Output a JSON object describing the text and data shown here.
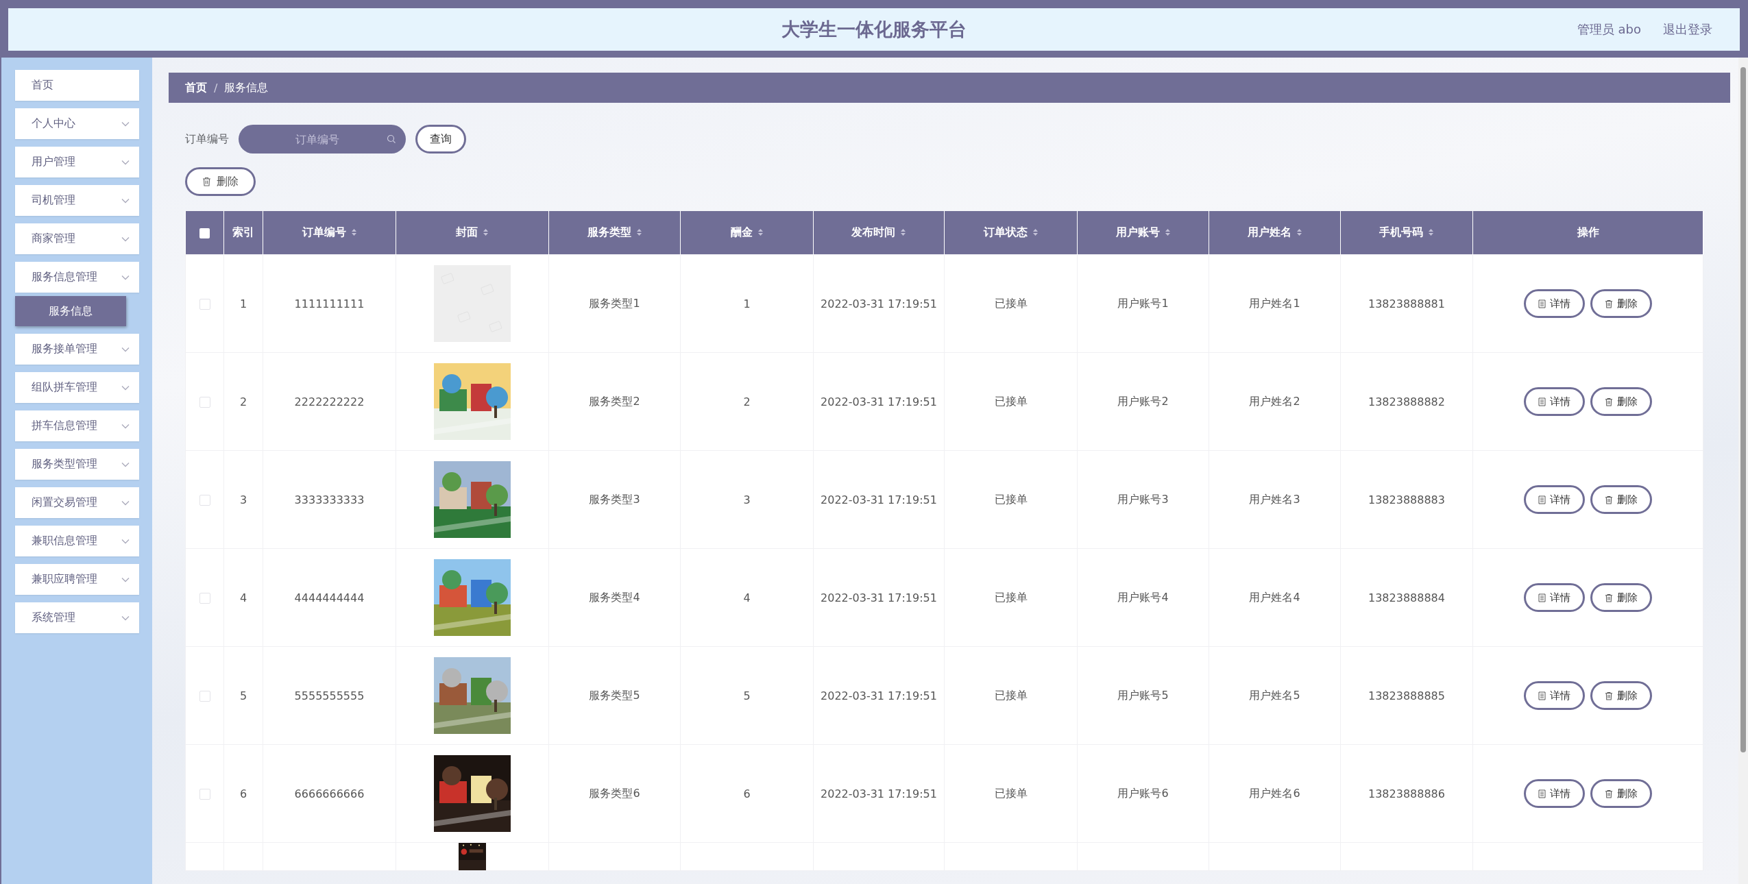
{
  "header": {
    "title": "大学生一体化服务平台",
    "user": "管理员 abo",
    "logout": "退出登录"
  },
  "sidebar": {
    "items": [
      {
        "label": "首页",
        "expandable": false
      },
      {
        "label": "个人中心",
        "expandable": true
      },
      {
        "label": "用户管理",
        "expandable": true
      },
      {
        "label": "司机管理",
        "expandable": true
      },
      {
        "label": "商家管理",
        "expandable": true
      },
      {
        "label": "服务信息管理",
        "expandable": true,
        "children": [
          {
            "label": "服务信息",
            "selected": true
          }
        ]
      },
      {
        "label": "服务接单管理",
        "expandable": true
      },
      {
        "label": "组队拼车管理",
        "expandable": true
      },
      {
        "label": "拼车信息管理",
        "expandable": true
      },
      {
        "label": "服务类型管理",
        "expandable": true
      },
      {
        "label": "闲置交易管理",
        "expandable": true
      },
      {
        "label": "兼职信息管理",
        "expandable": true
      },
      {
        "label": "兼职应聘管理",
        "expandable": true
      },
      {
        "label": "系统管理",
        "expandable": true
      }
    ]
  },
  "breadcrumb": {
    "items": [
      "首页",
      "服务信息"
    ],
    "separator": "/"
  },
  "search": {
    "label": "订单编号",
    "placeholder": "订单编号",
    "button": "查询"
  },
  "delete_button": "删除",
  "table": {
    "select_all": {
      "checked": false
    },
    "columns": [
      {
        "label": "索引",
        "sortable": false
      },
      {
        "label": "订单编号",
        "sortable": true
      },
      {
        "label": "封面",
        "sortable": true
      },
      {
        "label": "服务类型",
        "sortable": true
      },
      {
        "label": "酬金",
        "sortable": true
      },
      {
        "label": "发布时间",
        "sortable": true
      },
      {
        "label": "订单状态",
        "sortable": true
      },
      {
        "label": "用户账号",
        "sortable": true
      },
      {
        "label": "用户姓名",
        "sortable": true
      },
      {
        "label": "手机号码",
        "sortable": true
      },
      {
        "label": "操作",
        "sortable": false
      }
    ],
    "rows": [
      {
        "selected": false,
        "index": "1",
        "order_no": "1111111111",
        "cover": {
          "kind": "placeholder"
        },
        "type": "服务类型1",
        "reward": "1",
        "time": "2022-03-31 17:19:51",
        "status": "已接单",
        "account": "用户账号1",
        "name": "用户姓名1",
        "phone": "13823888881",
        "actions": [
          "详情",
          "删除"
        ]
      },
      {
        "selected": false,
        "index": "2",
        "order_no": "2222222222",
        "type": "服务类型2",
        "reward": "2",
        "time": "2022-03-31 17:19:51",
        "status": "已接单",
        "account": "用户账号2",
        "name": "用户姓名2",
        "phone": "13823888882",
        "actions": [
          "详情",
          "删除"
        ]
      },
      {
        "selected": false,
        "index": "3",
        "order_no": "3333333333",
        "type": "服务类型3",
        "reward": "3",
        "time": "2022-03-31 17:19:51",
        "status": "已接单",
        "account": "用户账号3",
        "name": "用户姓名3",
        "phone": "13823888883",
        "actions": [
          "详情",
          "删除"
        ]
      },
      {
        "selected": false,
        "index": "4",
        "order_no": "4444444444",
        "type": "服务类型4",
        "reward": "4",
        "time": "2022-03-31 17:19:51",
        "status": "已接单",
        "account": "用户账号4",
        "name": "用户姓名4",
        "phone": "13823888884",
        "actions": [
          "详情",
          "删除"
        ]
      },
      {
        "selected": false,
        "index": "5",
        "order_no": "5555555555",
        "type": "服务类型5",
        "reward": "5",
        "time": "2022-03-31 17:19:51",
        "status": "已接单",
        "account": "用户账号5",
        "name": "用户姓名5",
        "phone": "13823888885",
        "actions": [
          "详情",
          "删除"
        ]
      },
      {
        "selected": false,
        "index": "6",
        "order_no": "6666666666",
        "type": "服务类型6",
        "reward": "6",
        "time": "2022-03-31 17:19:51",
        "status": "已接单",
        "account": "用户账号6",
        "name": "用户姓名6",
        "phone": "13823888886",
        "actions": [
          "详情",
          "删除"
        ]
      }
    ]
  }
}
